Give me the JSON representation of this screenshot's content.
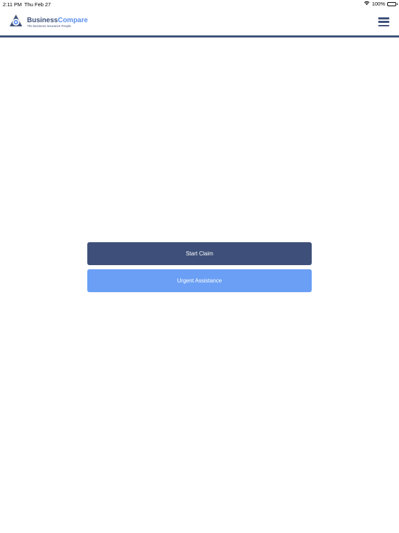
{
  "status_bar": {
    "time": "2:11 PM",
    "date": "Thu Feb 27",
    "battery": "100%",
    "icons": [
      "wifi-icon",
      "battery-icon"
    ]
  },
  "header": {
    "brand_part1": "Business",
    "brand_part2": "Compare",
    "tagline": "The Business Insurance People",
    "menu_icon": "hamburger-menu-icon"
  },
  "actions": {
    "start_claim": "Start Claim",
    "urgent_assistance": "Urgent Assistance"
  },
  "colors": {
    "brand_dark": "#3e5079",
    "brand_light": "#6a9ff5"
  }
}
